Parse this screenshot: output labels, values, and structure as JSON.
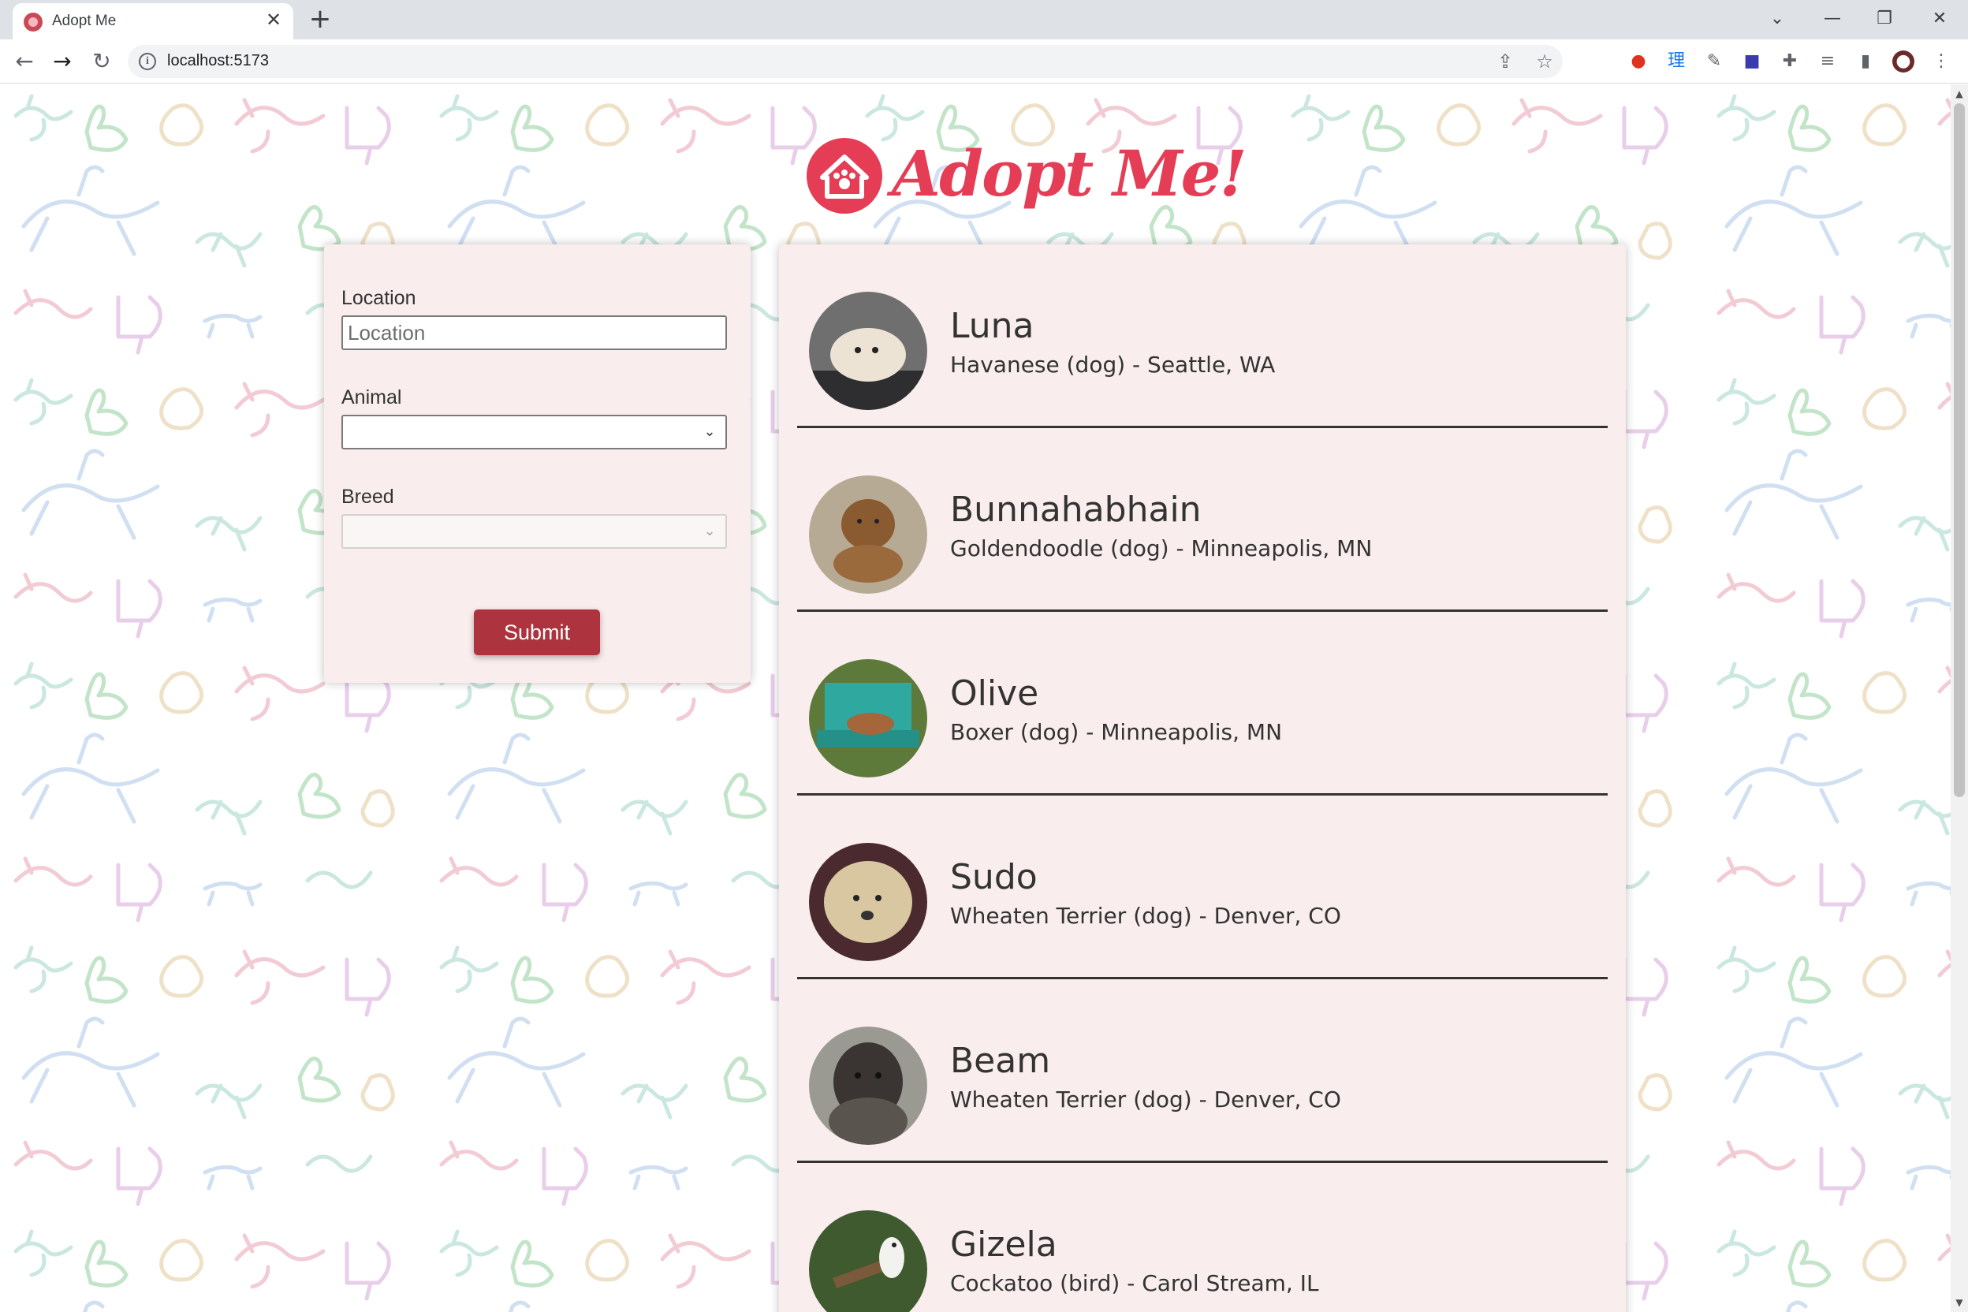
{
  "browser": {
    "tab_title": "Adopt Me",
    "tab_close": "✕",
    "new_tab": "+",
    "url": "localhost:5173",
    "window_controls": [
      "⌄",
      "—",
      "❐",
      "✕"
    ],
    "nav": {
      "back": "←",
      "forward": "→",
      "reload": "↻"
    }
  },
  "page": {
    "logo_text": "Adopt Me!",
    "search": {
      "location_label": "Location",
      "location_placeholder": "Location",
      "location_value": "",
      "animal_label": "Animal",
      "animal_value": "",
      "breed_label": "Breed",
      "breed_value": "",
      "submit_label": "Submit"
    },
    "pets": [
      {
        "name": "Luna",
        "description": "Havanese (dog) - Seattle, WA"
      },
      {
        "name": "Bunnahabhain",
        "description": "Goldendoodle (dog) - Minneapolis, MN"
      },
      {
        "name": "Olive",
        "description": "Boxer (dog) - Minneapolis, MN"
      },
      {
        "name": "Sudo",
        "description": "Wheaten Terrier (dog) - Denver, CO"
      },
      {
        "name": "Beam",
        "description": "Wheaten Terrier (dog) - Denver, CO"
      },
      {
        "name": "Gizela",
        "description": "Cockatoo (bird) - Carol Stream, IL"
      }
    ]
  },
  "colors": {
    "brand": "#e53d55",
    "panel_bg": "#f9eded",
    "submit_bg": "#ad343e",
    "text": "#333333"
  }
}
